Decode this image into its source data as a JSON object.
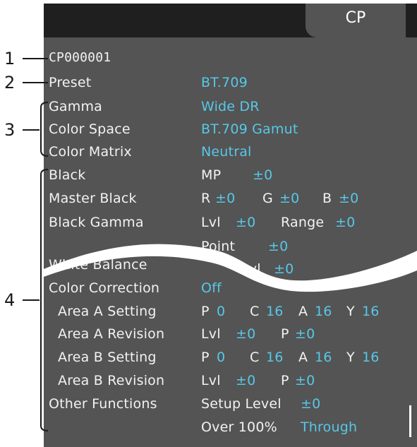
{
  "tab": {
    "label": "CP"
  },
  "callouts": [
    "1",
    "2",
    "3",
    "4"
  ],
  "header": {
    "id": "CP000001"
  },
  "rows": {
    "preset": {
      "label": "Preset",
      "value": "BT.709"
    },
    "gamma": {
      "label": "Gamma",
      "value": "Wide DR"
    },
    "color_space": {
      "label": "Color Space",
      "value": "BT.709 Gamut"
    },
    "color_matrix": {
      "label": "Color Matrix",
      "value": "Neutral"
    },
    "black": {
      "label": "Black",
      "k1": "MP",
      "v1": "±0"
    },
    "master_black": {
      "label": "Master Black",
      "k1": "R",
      "v1": "±0",
      "k2": "G",
      "v2": "±0",
      "k3": "B",
      "v3": "±0"
    },
    "black_gamma": {
      "label": "Black Gamma",
      "k1": "Lvl",
      "v1": "±0",
      "k2": "Range",
      "v2": "±0",
      "k3": "Point",
      "v3": "±0"
    },
    "white_balance": {
      "label": "White Balance",
      "k1": "Lvl",
      "v1": "±0"
    },
    "color_correction": {
      "label": "Color Correction",
      "value": "Off"
    },
    "area_a_setting": {
      "label": "Area A Setting",
      "k1": "P",
      "v1": "0",
      "k2": "C",
      "v2": "16",
      "k3": "A",
      "v3": "16",
      "k4": "Y",
      "v4": "16"
    },
    "area_a_revision": {
      "label": "Area A Revision",
      "k1": "Lvl",
      "v1": "±0",
      "k2": "P",
      "v2": "±0"
    },
    "area_b_setting": {
      "label": "Area B Setting",
      "k1": "P",
      "v1": "0",
      "k2": "C",
      "v2": "16",
      "k3": "A",
      "v3": "16",
      "k4": "Y",
      "v4": "16"
    },
    "area_b_revision": {
      "label": "Area B Revision",
      "k1": "Lvl",
      "v1": "±0",
      "k2": "P",
      "v2": "±0"
    },
    "other_functions": {
      "label": "Other Functions",
      "k1": "Setup Level",
      "v1": "±0",
      "k2": "Over 100%",
      "v2": "Through"
    }
  },
  "colors": {
    "panel": "#545454",
    "topbar": "#1f1f1f",
    "accent": "#56c8e8",
    "text": "#f2f2f2"
  }
}
